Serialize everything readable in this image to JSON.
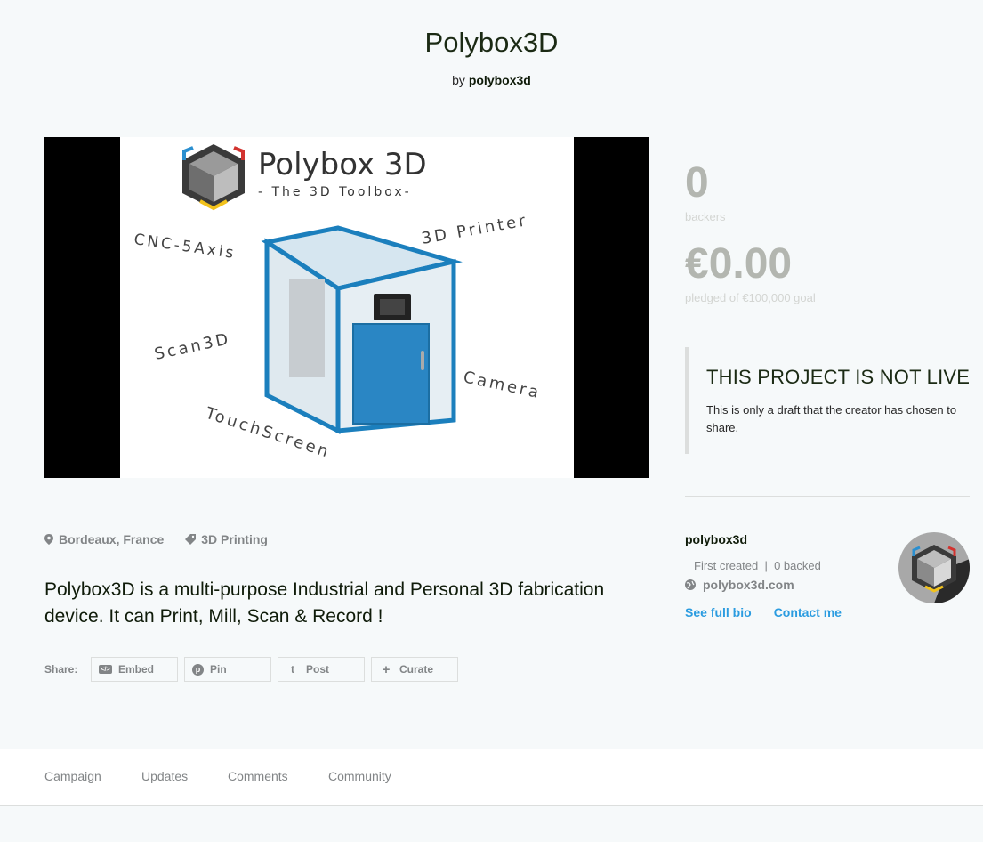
{
  "project": {
    "title": "Polybox3D",
    "by_prefix": "by",
    "creator": "polybox3d"
  },
  "video": {
    "logo_title": "Polybox 3D",
    "logo_subtitle": "- The 3D Toolbox-",
    "features": [
      "CNC-5Axis",
      "3D Printer",
      "Scan3D",
      "Camera",
      "TouchScreen"
    ]
  },
  "stats": {
    "backers_count": "0",
    "backers_label": "backers",
    "pledged_amount": "€0.00",
    "pledged_label": "pledged of €100,000 goal"
  },
  "notice": {
    "heading": "THIS PROJECT IS NOT LIVE",
    "body": "This is only a draft that the creator has chosen to share."
  },
  "meta": {
    "location": "Bordeaux, France",
    "category": "3D Printing"
  },
  "blurb": "Polybox3D is a multi-purpose Industrial and Personal 3D fabrication device. It can Print, Mill, Scan & Record !",
  "share": {
    "label": "Share:",
    "buttons": [
      {
        "label": "Embed",
        "icon": "embed-icon"
      },
      {
        "label": "Pin",
        "icon": "pinterest-icon"
      },
      {
        "label": "Post",
        "icon": "tumblr-icon"
      },
      {
        "label": "Curate",
        "icon": "plus-icon"
      }
    ]
  },
  "creator": {
    "name": "polybox3d",
    "counts": "First created  |  0 backed",
    "website": "polybox3d.com",
    "see_bio": "See full bio",
    "contact": "Contact me"
  },
  "tabs": [
    "Campaign",
    "Updates",
    "Comments",
    "Community"
  ],
  "colors": {
    "background": "#f6f9fa",
    "link_blue": "#2b9ce0",
    "device_blue": "#1b7fbd",
    "stat_gray": "#b3b6b0"
  }
}
